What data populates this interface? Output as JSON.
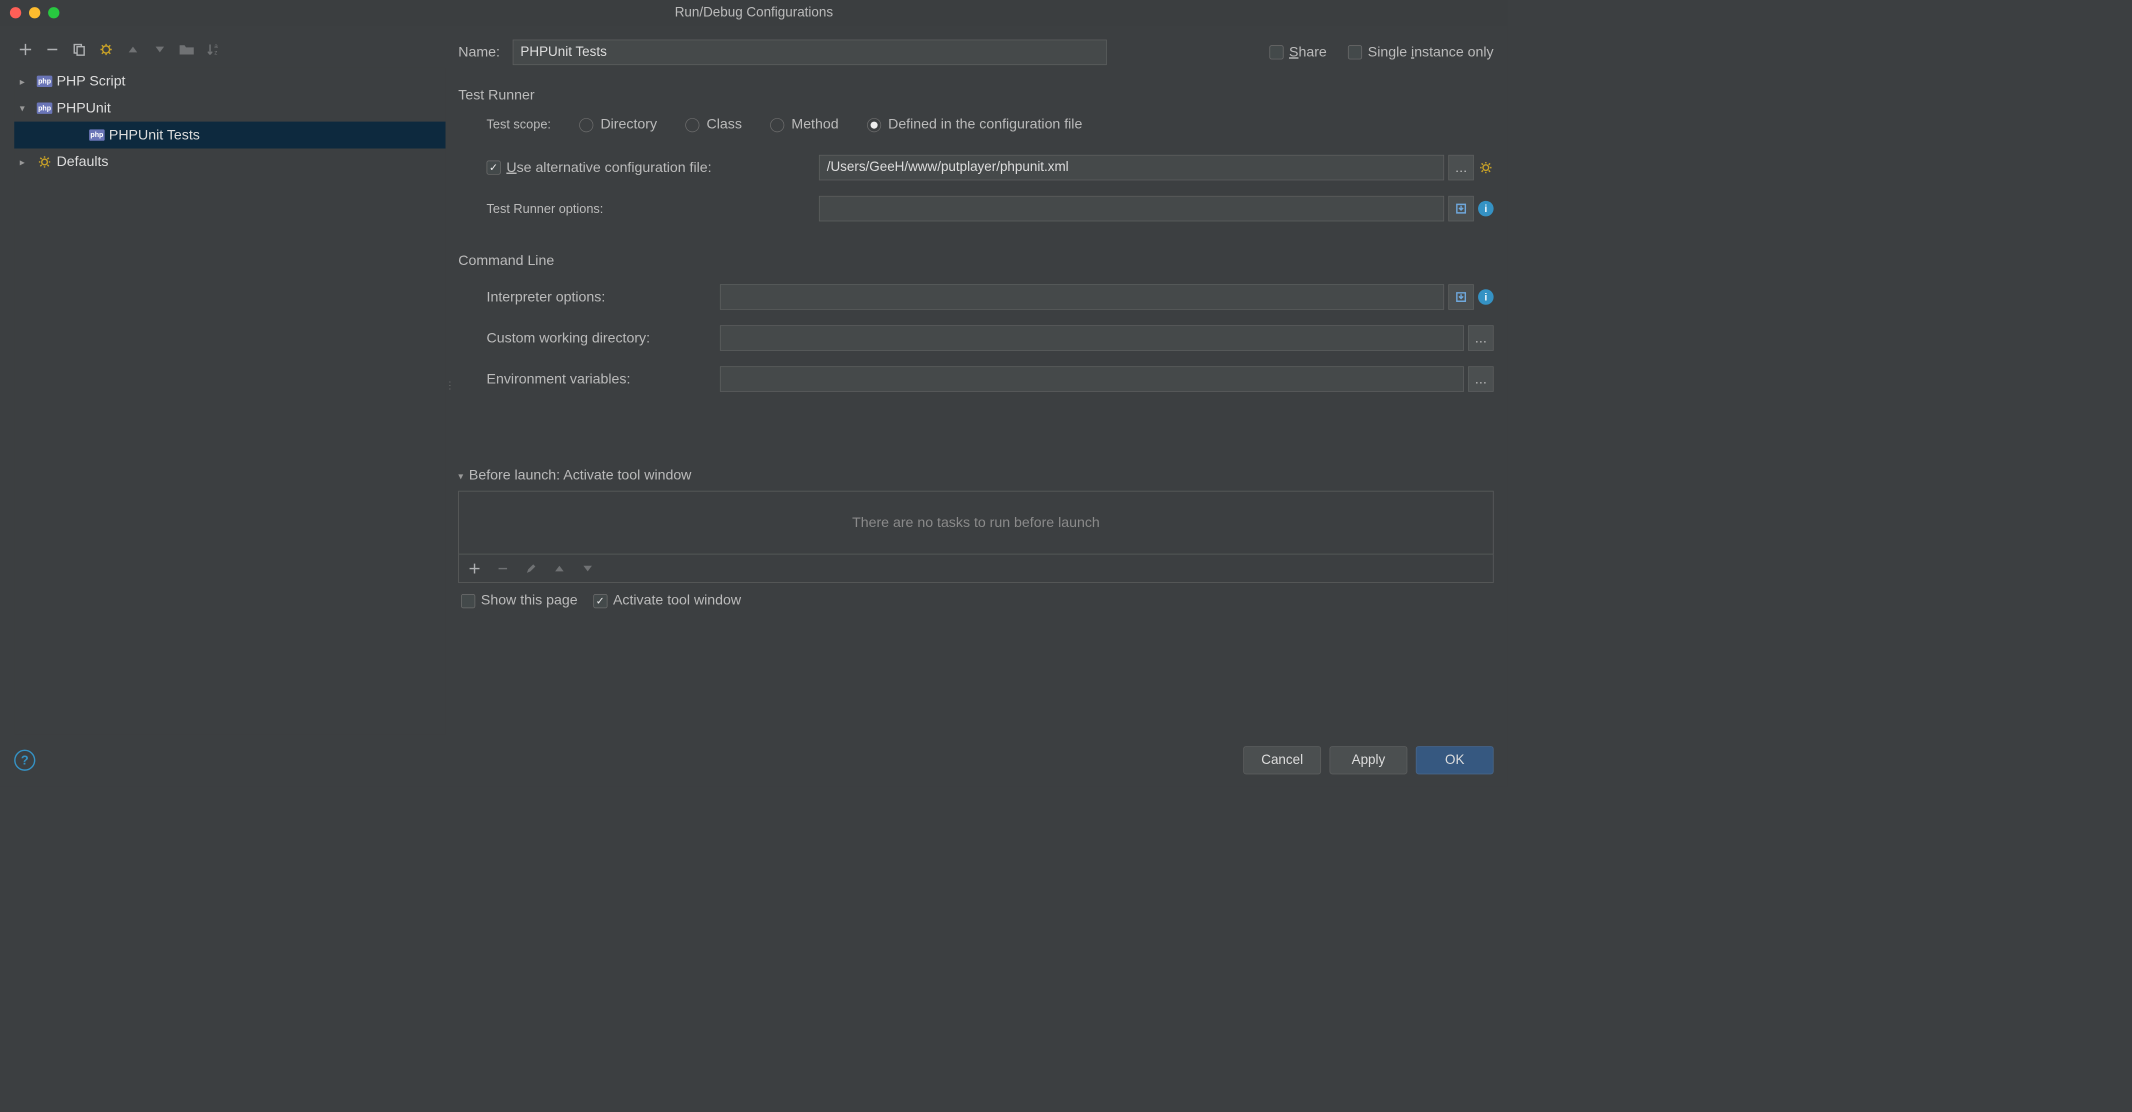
{
  "window": {
    "title": "Run/Debug Configurations"
  },
  "toolbar": {
    "add": "+",
    "remove": "−",
    "copy": "copy",
    "settings": "settings",
    "up": "▲",
    "down": "▼",
    "folder": "folder",
    "sort": "sort"
  },
  "tree": {
    "items": [
      {
        "label": "PHP Script",
        "arrow": "right",
        "icon": "php",
        "indent": 0,
        "selected": false
      },
      {
        "label": "PHPUnit",
        "arrow": "down",
        "icon": "php",
        "indent": 0,
        "selected": false
      },
      {
        "label": "PHPUnit Tests",
        "arrow": "none",
        "icon": "php",
        "indent": 2,
        "selected": true
      },
      {
        "label": "Defaults",
        "arrow": "right",
        "icon": "gear",
        "indent": 0,
        "selected": false
      }
    ]
  },
  "name": {
    "label": "Name:",
    "value": "PHPUnit Tests"
  },
  "topChecks": {
    "share": {
      "label": "Share",
      "checked": false,
      "ukey": "S"
    },
    "single": {
      "label": "Single instance only",
      "checked": false,
      "ukey": "i"
    }
  },
  "testRunner": {
    "title": "Test Runner",
    "scope": {
      "label": "Test scope:",
      "options": [
        "Directory",
        "Class",
        "Method",
        "Defined in the configuration file"
      ],
      "selected": 3
    },
    "useAltCfg": {
      "label": "Use alternative configuration file:",
      "checked": true,
      "ukey": "U"
    },
    "altCfgPath": "/Users/GeeH/www/putplayer/phpunit.xml",
    "runnerOptions": {
      "label": "Test Runner options:",
      "value": ""
    }
  },
  "commandLine": {
    "title": "Command Line",
    "interpreterOptions": {
      "label": "Interpreter options:",
      "value": ""
    },
    "customWorkingDir": {
      "label": "Custom working directory:",
      "value": ""
    },
    "envVars": {
      "label": "Environment variables:",
      "value": ""
    }
  },
  "beforeLaunch": {
    "title": "Before launch: Activate tool window",
    "empty": "There are no tasks to run before launch",
    "showPage": {
      "label": "Show this page",
      "checked": false
    },
    "activateTool": {
      "label": "Activate tool window",
      "checked": true
    }
  },
  "footer": {
    "cancel": "Cancel",
    "apply": "Apply",
    "ok": "OK"
  }
}
